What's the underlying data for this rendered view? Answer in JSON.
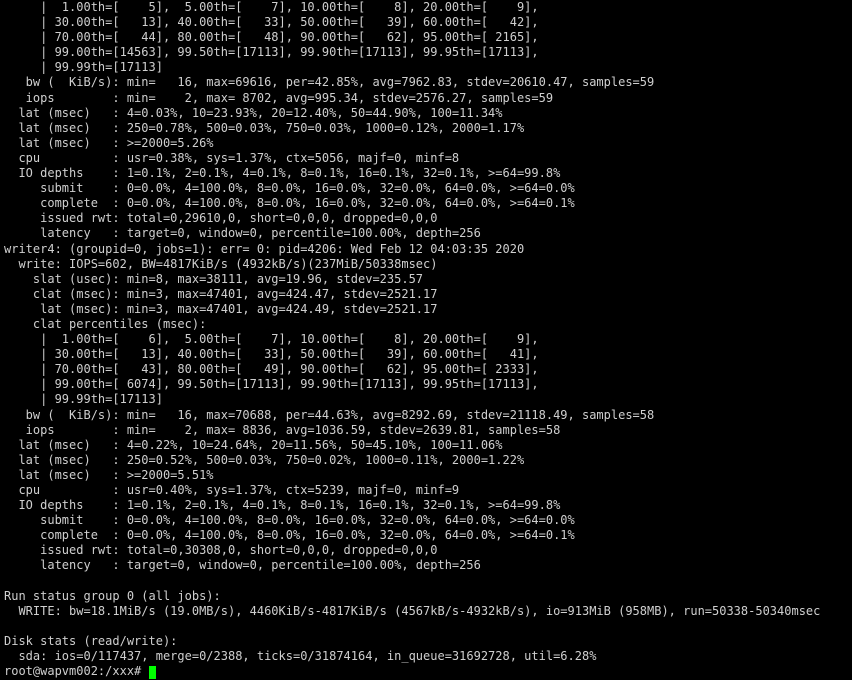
{
  "lines": [
    "     |  1.00th=[    5],  5.00th=[    7], 10.00th=[    8], 20.00th=[    9],",
    "     | 30.00th=[   13], 40.00th=[   33], 50.00th=[   39], 60.00th=[   42],",
    "     | 70.00th=[   44], 80.00th=[   48], 90.00th=[   62], 95.00th=[ 2165],",
    "     | 99.00th=[14563], 99.50th=[17113], 99.90th=[17113], 99.95th=[17113],",
    "     | 99.99th=[17113]",
    "   bw (  KiB/s): min=   16, max=69616, per=42.85%, avg=7962.83, stdev=20610.47, samples=59",
    "   iops        : min=    2, max= 8702, avg=995.34, stdev=2576.27, samples=59",
    "  lat (msec)   : 4=0.03%, 10=23.93%, 20=12.40%, 50=44.90%, 100=11.34%",
    "  lat (msec)   : 250=0.78%, 500=0.03%, 750=0.03%, 1000=0.12%, 2000=1.17%",
    "  lat (msec)   : >=2000=5.26%",
    "  cpu          : usr=0.38%, sys=1.37%, ctx=5056, majf=0, minf=8",
    "  IO depths    : 1=0.1%, 2=0.1%, 4=0.1%, 8=0.1%, 16=0.1%, 32=0.1%, >=64=99.8%",
    "     submit    : 0=0.0%, 4=100.0%, 8=0.0%, 16=0.0%, 32=0.0%, 64=0.0%, >=64=0.0%",
    "     complete  : 0=0.0%, 4=100.0%, 8=0.0%, 16=0.0%, 32=0.0%, 64=0.0%, >=64=0.1%",
    "     issued rwt: total=0,29610,0, short=0,0,0, dropped=0,0,0",
    "     latency   : target=0, window=0, percentile=100.00%, depth=256",
    "writer4: (groupid=0, jobs=1): err= 0: pid=4206: Wed Feb 12 04:03:35 2020",
    "  write: IOPS=602, BW=4817KiB/s (4932kB/s)(237MiB/50338msec)",
    "    slat (usec): min=8, max=38111, avg=19.96, stdev=235.57",
    "    clat (msec): min=3, max=47401, avg=424.47, stdev=2521.17",
    "     lat (msec): min=3, max=47401, avg=424.49, stdev=2521.17",
    "    clat percentiles (msec):",
    "     |  1.00th=[    6],  5.00th=[    7], 10.00th=[    8], 20.00th=[    9],",
    "     | 30.00th=[   13], 40.00th=[   33], 50.00th=[   39], 60.00th=[   41],",
    "     | 70.00th=[   43], 80.00th=[   49], 90.00th=[   62], 95.00th=[ 2333],",
    "     | 99.00th=[ 6074], 99.50th=[17113], 99.90th=[17113], 99.95th=[17113],",
    "     | 99.99th=[17113]",
    "   bw (  KiB/s): min=   16, max=70688, per=44.63%, avg=8292.69, stdev=21118.49, samples=58",
    "   iops        : min=    2, max= 8836, avg=1036.59, stdev=2639.81, samples=58",
    "  lat (msec)   : 4=0.22%, 10=24.64%, 20=11.56%, 50=45.10%, 100=11.06%",
    "  lat (msec)   : 250=0.52%, 500=0.03%, 750=0.02%, 1000=0.11%, 2000=1.22%",
    "  lat (msec)   : >=2000=5.51%",
    "  cpu          : usr=0.40%, sys=1.37%, ctx=5239, majf=0, minf=9",
    "  IO depths    : 1=0.1%, 2=0.1%, 4=0.1%, 8=0.1%, 16=0.1%, 32=0.1%, >=64=99.8%",
    "     submit    : 0=0.0%, 4=100.0%, 8=0.0%, 16=0.0%, 32=0.0%, 64=0.0%, >=64=0.0%",
    "     complete  : 0=0.0%, 4=100.0%, 8=0.0%, 16=0.0%, 32=0.0%, 64=0.0%, >=64=0.1%",
    "     issued rwt: total=0,30308,0, short=0,0,0, dropped=0,0,0",
    "     latency   : target=0, window=0, percentile=100.00%, depth=256",
    "",
    "Run status group 0 (all jobs):",
    "  WRITE: bw=18.1MiB/s (19.0MB/s), 4460KiB/s-4817KiB/s (4567kB/s-4932kB/s), io=913MiB (958MB), run=50338-50340msec",
    "",
    "Disk stats (read/write):",
    "  sda: ios=0/117437, merge=0/2388, ticks=0/31874164, in_queue=31692728, util=6.28%"
  ],
  "prompt": "root@wapvm002:/xxx# "
}
